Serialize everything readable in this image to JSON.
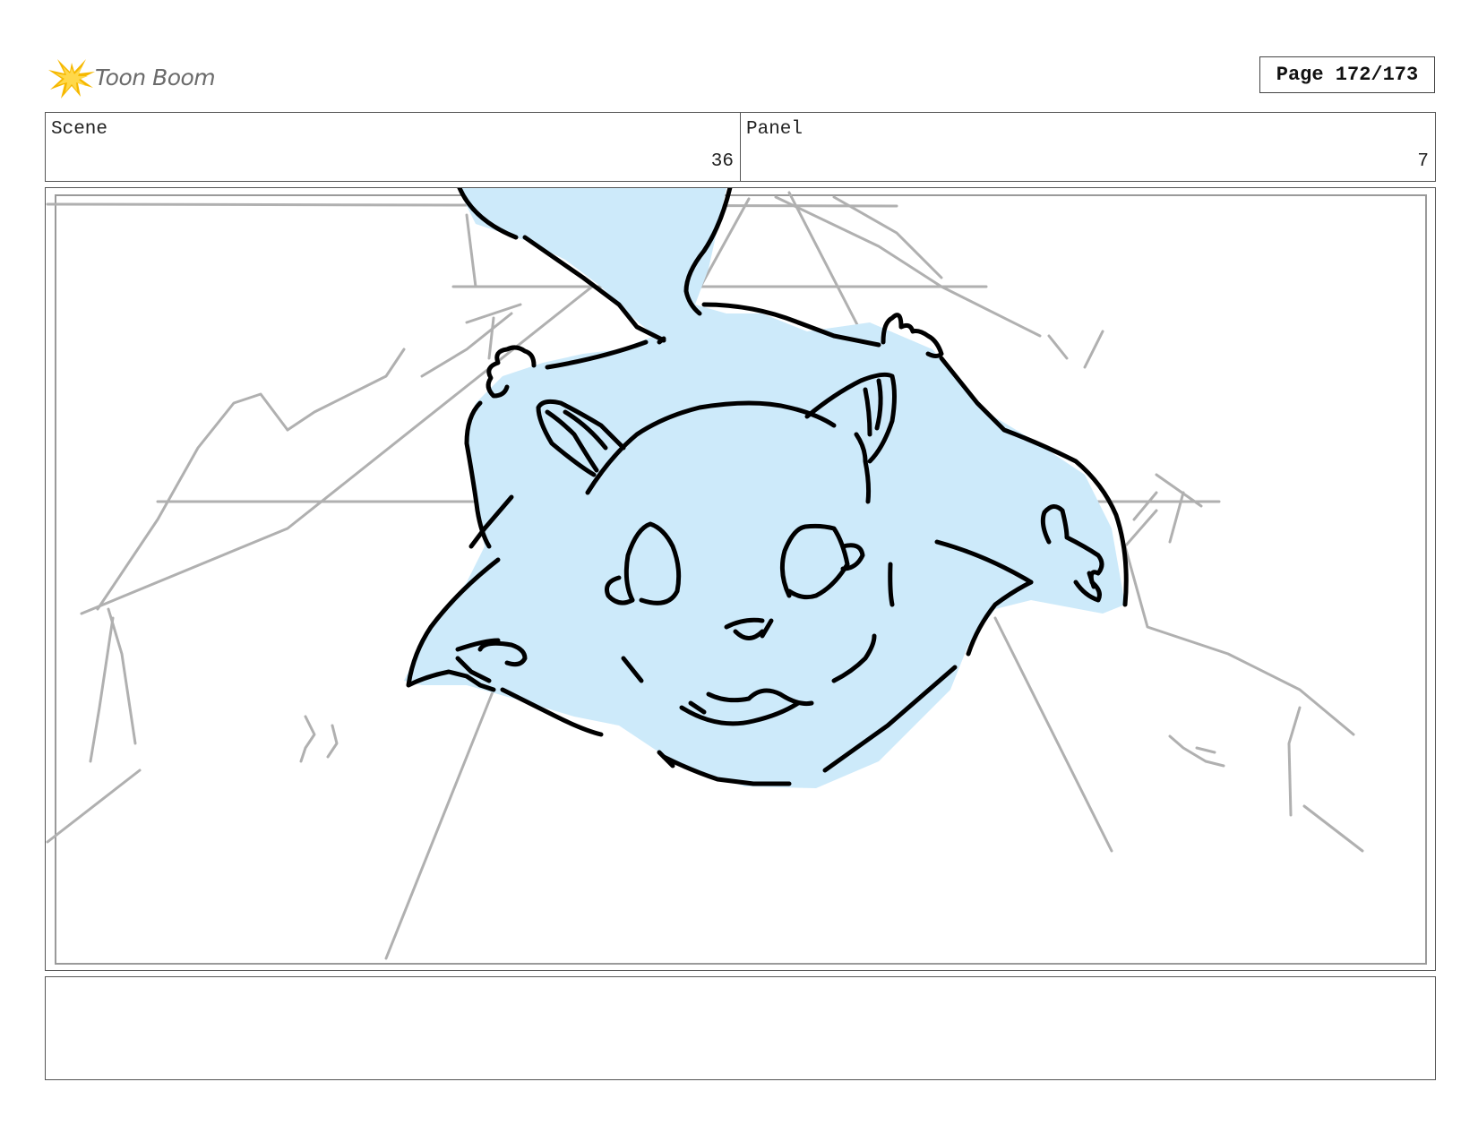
{
  "header": {
    "logo_text": "Toon Boom",
    "page_label": "Page 172/173"
  },
  "info": {
    "scene_label": "Scene",
    "scene_value": "36",
    "panel_label": "Panel",
    "panel_value": "7"
  },
  "panel_image": {
    "fill_color": "#cdeafa",
    "ink_color": "#000000",
    "rough_color": "#b0b0b0"
  },
  "notes": {
    "text": ""
  }
}
